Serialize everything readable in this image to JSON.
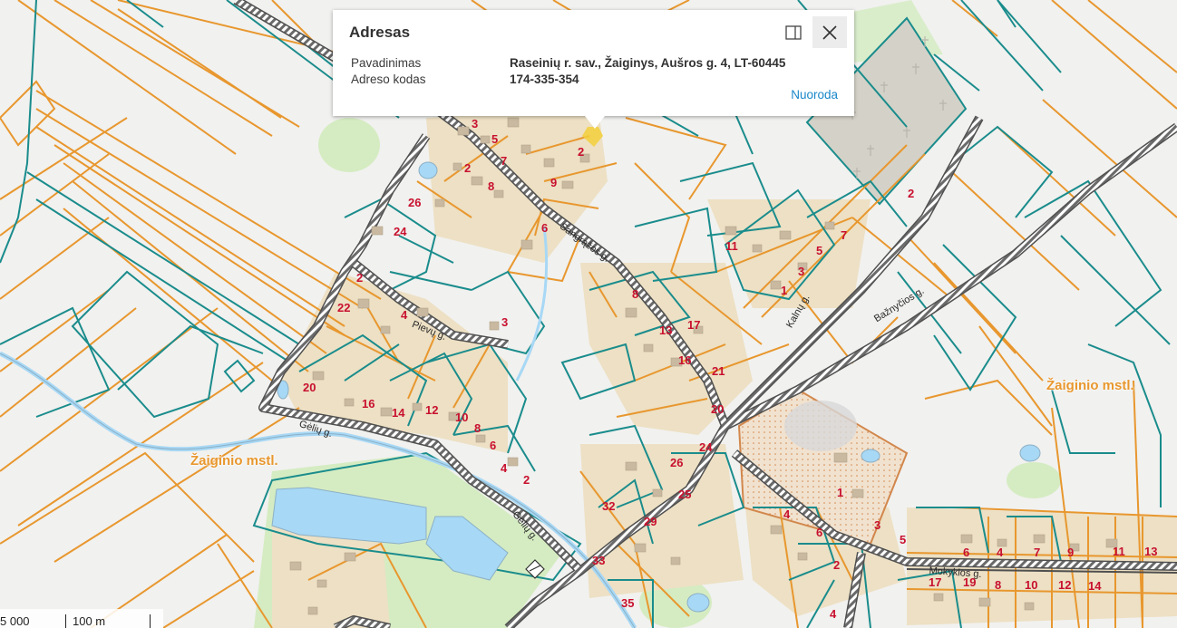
{
  "popup": {
    "title": "Adresas",
    "rows": [
      {
        "label": "Pavadinimas",
        "value": "Raseinių r. sav., Žaiginys, Aušros g. 4, LT-60445"
      },
      {
        "label": "Adreso kodas",
        "value": "174-335-354"
      }
    ],
    "link": "Nuoroda",
    "dock_icon": "dock-icon",
    "close_icon": "close-icon"
  },
  "map": {
    "street_labels": [
      "Sangrąžos g.",
      "Pievų g.",
      "Gėlių g.",
      "Gėlių g.",
      "Kalnų g.",
      "Bažnyčios g.",
      "Mokyklos g."
    ],
    "area_labels": [
      "Žaiginio mstl.",
      "Žaiginio mstl."
    ],
    "house_numbers": [
      "3",
      "5",
      "2",
      "7",
      "8",
      "9",
      "6",
      "26",
      "24",
      "2",
      "22",
      "4",
      "3",
      "20",
      "16",
      "14",
      "12",
      "10",
      "8",
      "6",
      "4",
      "2",
      "11",
      "5",
      "7",
      "3",
      "1",
      "2",
      "8",
      "13",
      "17",
      "16",
      "21",
      "20",
      "24",
      "26",
      "25",
      "32",
      "29",
      "33",
      "35",
      "1",
      "3",
      "5",
      "4",
      "6",
      "2",
      "2",
      "4",
      "6",
      "4",
      "7",
      "9",
      "11",
      "13",
      "17",
      "19",
      "8",
      "10",
      "12",
      "14",
      "16",
      "18",
      "2"
    ],
    "colors": {
      "parcel": "#e8972e",
      "boundary": "#1a8c8c",
      "road": "#5a5a5a",
      "water": "#a7d8f5",
      "house_number": "#c8102e",
      "area_label": "#e8972e",
      "building_area": "#ede0c4",
      "green": "#d5ecc2"
    }
  },
  "scale": {
    "left_label": "5 000",
    "right_label": "100 m"
  }
}
